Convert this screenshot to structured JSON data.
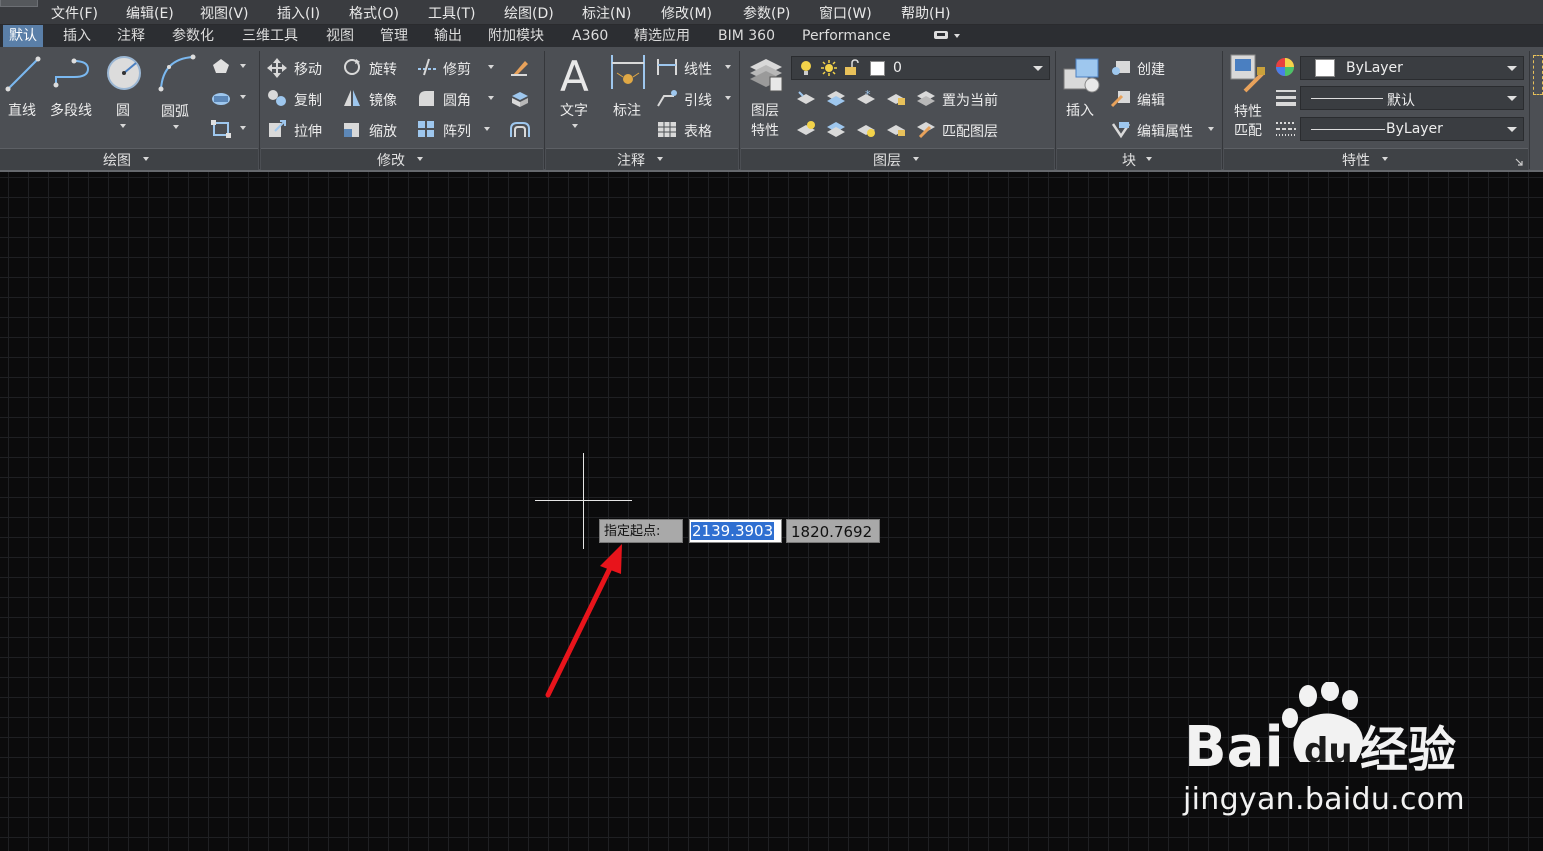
{
  "menubar": {
    "items": [
      "文件(F)",
      "编辑(E)",
      "视图(V)",
      "插入(I)",
      "格式(O)",
      "工具(T)",
      "绘图(D)",
      "标注(N)",
      "修改(M)",
      "参数(P)",
      "窗口(W)",
      "帮助(H)"
    ]
  },
  "tabs": {
    "items": [
      "默认",
      "插入",
      "注释",
      "参数化",
      "三维工具",
      "视图",
      "管理",
      "输出",
      "附加模块",
      "A360",
      "精选应用",
      "BIM 360",
      "Performance"
    ],
    "active": "默认"
  },
  "ribbon": {
    "draw": {
      "title": "绘图",
      "line": "直线",
      "polyline": "多段线",
      "circle": "圆",
      "arc": "圆弧"
    },
    "modify": {
      "title": "修改",
      "move": "移动",
      "rotate": "旋转",
      "trim": "修剪",
      "copy": "复制",
      "mirror": "镜像",
      "fillet": "圆角",
      "stretch": "拉伸",
      "scale": "缩放",
      "array": "阵列"
    },
    "annotation": {
      "title": "注释",
      "text": "文字",
      "dimension": "标注",
      "linear": "线性",
      "leader": "引线",
      "table": "表格"
    },
    "layers": {
      "title": "图层",
      "layer_props_1": "图层",
      "layer_props_2": "特性",
      "current_layer": "0",
      "set_current": "置为当前",
      "match_layer": "匹配图层"
    },
    "block": {
      "title": "块",
      "insert": "插入",
      "create": "创建",
      "edit": "编辑",
      "edit_attr": "编辑属性"
    },
    "properties": {
      "title": "特性",
      "match_1": "特性",
      "match_2": "匹配",
      "color": "ByLayer",
      "linetype": "默认",
      "lineweight": "ByLayer"
    }
  },
  "dynamic_input": {
    "prompt": "指定起点:",
    "x_value": "2139.3903",
    "y_value": "1820.7692"
  },
  "watermark": {
    "brand": "Baidu经验",
    "url": "jingyan.baidu.com"
  },
  "colors": {
    "annotation_arrow": "#e8141b",
    "selection": "#2f6fd1",
    "active_tab": "#5a7fa8"
  }
}
